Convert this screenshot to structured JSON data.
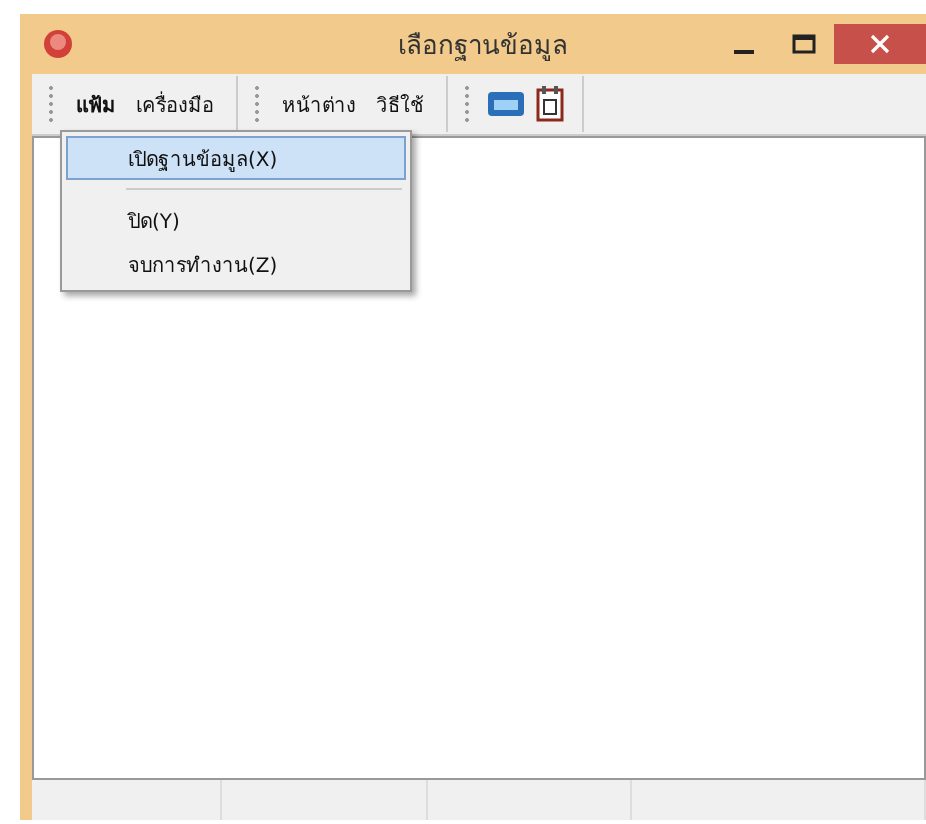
{
  "window": {
    "title": "เลือกฐานข้อมูล"
  },
  "menubar": [
    [
      {
        "label": "แฟ้ม",
        "selected": true
      },
      {
        "label": "เครื่องมือ",
        "selected": false
      }
    ],
    [
      {
        "label": "หน้าต่าง",
        "selected": false
      },
      {
        "label": "วิธีใช้",
        "selected": false
      }
    ]
  ],
  "toolbar": [
    {
      "kind": "calculator"
    },
    {
      "kind": "calendar"
    }
  ],
  "menu": [
    {
      "kind": "item",
      "label": "เปิดฐานข้อมูล(X)",
      "selected": true
    },
    {
      "kind": "separator"
    },
    {
      "kind": "item",
      "label": "ปิด(Y)",
      "selected": false
    },
    {
      "kind": "item",
      "label": "จบการทำงาน(Z)",
      "selected": false
    }
  ]
}
